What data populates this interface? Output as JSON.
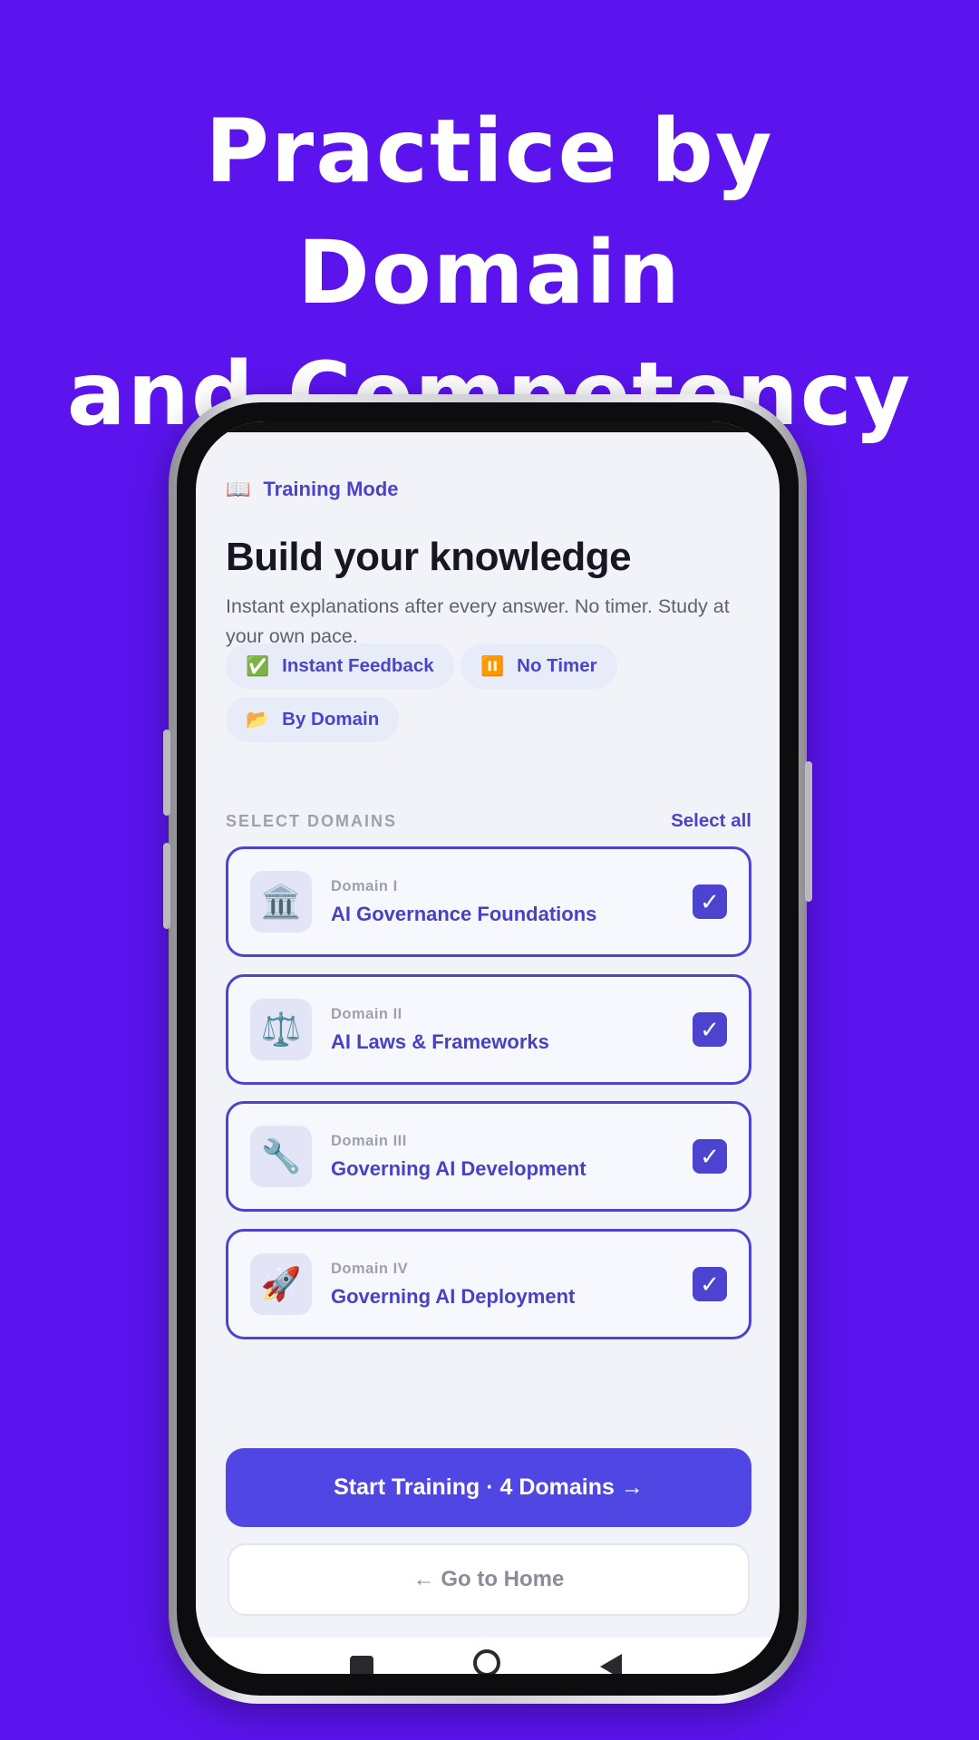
{
  "promo": {
    "headline_line1": "Practice by Domain",
    "headline_line2": "and Competency",
    "background_color": "#5b14ee"
  },
  "header": {
    "mode_icon": "book-icon",
    "mode_icon_glyph": "📖",
    "mode_label": "Training Mode"
  },
  "main": {
    "title": "Build your knowledge",
    "subtitle": "Instant explanations after every answer. No timer. Study at your own pace."
  },
  "features": [
    {
      "icon": "check-icon",
      "glyph": "✅",
      "label": "Instant Feedback"
    },
    {
      "icon": "pause-icon",
      "glyph": "⏸️",
      "label": "No Timer"
    },
    {
      "icon": "folder-icon",
      "glyph": "📂",
      "label": "By Domain"
    }
  ],
  "domains_section": {
    "label": "SELECT DOMAINS",
    "select_all_label": "Select all"
  },
  "domains": [
    {
      "number": "Domain I",
      "name": "AI Governance Foundations",
      "icon": "classical-building-icon",
      "glyph": "🏛️",
      "checked": true,
      "check": "✓"
    },
    {
      "number": "Domain II",
      "name": "AI Laws & Frameworks",
      "icon": "balance-scale-icon",
      "glyph": "⚖️",
      "checked": true,
      "check": "✓"
    },
    {
      "number": "Domain III",
      "name": "Governing AI Development",
      "icon": "wrench-icon",
      "glyph": "🔧",
      "checked": true,
      "check": "✓"
    },
    {
      "number": "Domain IV",
      "name": "Governing AI Deployment",
      "icon": "rocket-icon",
      "glyph": "🚀",
      "checked": true,
      "check": "✓"
    }
  ],
  "actions": {
    "start_label": "Start Training · 4 Domains →",
    "home_label": "← Go to Home"
  },
  "colors": {
    "accent": "#4f46e3",
    "accent_text": "#4b44c8",
    "screen_bg": "#f1f3f8"
  }
}
